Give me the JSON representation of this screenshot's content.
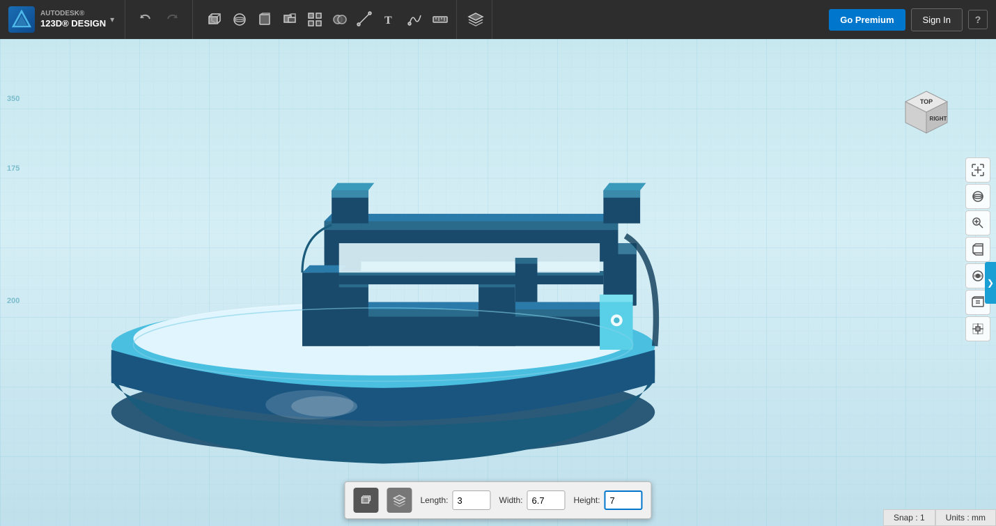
{
  "app": {
    "brand": "AUTODESK®",
    "product": "123D® DESIGN"
  },
  "toolbar": {
    "undo_label": "↩",
    "redo_label": "↪",
    "premium_label": "Go Premium",
    "signin_label": "Sign In",
    "help_label": "?"
  },
  "tool_groups": [
    {
      "id": "primitives",
      "tools": [
        "box3d",
        "sketch",
        "transform",
        "modify",
        "pattern",
        "combine",
        "measure",
        "text",
        "freeform",
        "ruler"
      ]
    },
    {
      "id": "layers",
      "tools": [
        "layers"
      ]
    }
  ],
  "nav_cube": {
    "top_label": "TOP",
    "right_label": "RIGHT"
  },
  "bottom_panel": {
    "length_label": "Length:",
    "length_value": "3",
    "width_label": "Width:",
    "width_value": "6.7",
    "height_label": "Height:",
    "height_value": "7"
  },
  "status_bar": {
    "snap_label": "Snap : 1",
    "units_label": "Units : mm"
  },
  "axis_labels": {
    "y1": "350",
    "y2": "175",
    "y3": "200"
  },
  "viewport": {
    "background_top": "#c5e8f2",
    "background_bottom": "#b8dde8"
  }
}
